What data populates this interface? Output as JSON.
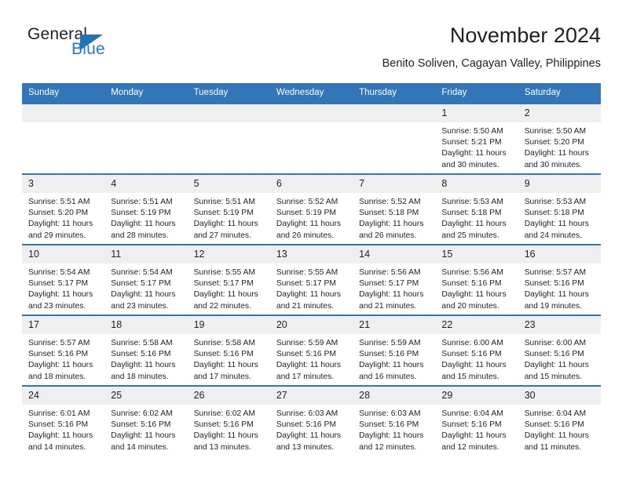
{
  "brand": {
    "name_part1": "General",
    "name_part2": "Blue",
    "triangle_color": "#2272b5",
    "text_color": "#231f20",
    "blue_text_color": "#2779bd"
  },
  "header": {
    "title": "November 2024",
    "subtitle": "Benito Soliven, Cagayan Valley, Philippines"
  },
  "theme": {
    "header_bar_color": "#3275b8",
    "daynum_band_color": "#efeff0",
    "row_divider_color": "#3275b8",
    "text_color": "#231f20"
  },
  "calendar": {
    "weekday_headers": [
      "Sunday",
      "Monday",
      "Tuesday",
      "Wednesday",
      "Thursday",
      "Friday",
      "Saturday"
    ],
    "weeks": [
      [
        {
          "day": "",
          "empty": true,
          "sunrise": "",
          "sunset": "",
          "daylight_line1": "",
          "daylight_line2": ""
        },
        {
          "day": "",
          "empty": true,
          "sunrise": "",
          "sunset": "",
          "daylight_line1": "",
          "daylight_line2": ""
        },
        {
          "day": "",
          "empty": true,
          "sunrise": "",
          "sunset": "",
          "daylight_line1": "",
          "daylight_line2": ""
        },
        {
          "day": "",
          "empty": true,
          "sunrise": "",
          "sunset": "",
          "daylight_line1": "",
          "daylight_line2": ""
        },
        {
          "day": "",
          "empty": true,
          "sunrise": "",
          "sunset": "",
          "daylight_line1": "",
          "daylight_line2": ""
        },
        {
          "day": "1",
          "empty": false,
          "sunrise": "Sunrise: 5:50 AM",
          "sunset": "Sunset: 5:21 PM",
          "daylight_line1": "Daylight: 11 hours",
          "daylight_line2": "and 30 minutes."
        },
        {
          "day": "2",
          "empty": false,
          "sunrise": "Sunrise: 5:50 AM",
          "sunset": "Sunset: 5:20 PM",
          "daylight_line1": "Daylight: 11 hours",
          "daylight_line2": "and 30 minutes."
        }
      ],
      [
        {
          "day": "3",
          "empty": false,
          "sunrise": "Sunrise: 5:51 AM",
          "sunset": "Sunset: 5:20 PM",
          "daylight_line1": "Daylight: 11 hours",
          "daylight_line2": "and 29 minutes."
        },
        {
          "day": "4",
          "empty": false,
          "sunrise": "Sunrise: 5:51 AM",
          "sunset": "Sunset: 5:19 PM",
          "daylight_line1": "Daylight: 11 hours",
          "daylight_line2": "and 28 minutes."
        },
        {
          "day": "5",
          "empty": false,
          "sunrise": "Sunrise: 5:51 AM",
          "sunset": "Sunset: 5:19 PM",
          "daylight_line1": "Daylight: 11 hours",
          "daylight_line2": "and 27 minutes."
        },
        {
          "day": "6",
          "empty": false,
          "sunrise": "Sunrise: 5:52 AM",
          "sunset": "Sunset: 5:19 PM",
          "daylight_line1": "Daylight: 11 hours",
          "daylight_line2": "and 26 minutes."
        },
        {
          "day": "7",
          "empty": false,
          "sunrise": "Sunrise: 5:52 AM",
          "sunset": "Sunset: 5:18 PM",
          "daylight_line1": "Daylight: 11 hours",
          "daylight_line2": "and 26 minutes."
        },
        {
          "day": "8",
          "empty": false,
          "sunrise": "Sunrise: 5:53 AM",
          "sunset": "Sunset: 5:18 PM",
          "daylight_line1": "Daylight: 11 hours",
          "daylight_line2": "and 25 minutes."
        },
        {
          "day": "9",
          "empty": false,
          "sunrise": "Sunrise: 5:53 AM",
          "sunset": "Sunset: 5:18 PM",
          "daylight_line1": "Daylight: 11 hours",
          "daylight_line2": "and 24 minutes."
        }
      ],
      [
        {
          "day": "10",
          "empty": false,
          "sunrise": "Sunrise: 5:54 AM",
          "sunset": "Sunset: 5:17 PM",
          "daylight_line1": "Daylight: 11 hours",
          "daylight_line2": "and 23 minutes."
        },
        {
          "day": "11",
          "empty": false,
          "sunrise": "Sunrise: 5:54 AM",
          "sunset": "Sunset: 5:17 PM",
          "daylight_line1": "Daylight: 11 hours",
          "daylight_line2": "and 23 minutes."
        },
        {
          "day": "12",
          "empty": false,
          "sunrise": "Sunrise: 5:55 AM",
          "sunset": "Sunset: 5:17 PM",
          "daylight_line1": "Daylight: 11 hours",
          "daylight_line2": "and 22 minutes."
        },
        {
          "day": "13",
          "empty": false,
          "sunrise": "Sunrise: 5:55 AM",
          "sunset": "Sunset: 5:17 PM",
          "daylight_line1": "Daylight: 11 hours",
          "daylight_line2": "and 21 minutes."
        },
        {
          "day": "14",
          "empty": false,
          "sunrise": "Sunrise: 5:56 AM",
          "sunset": "Sunset: 5:17 PM",
          "daylight_line1": "Daylight: 11 hours",
          "daylight_line2": "and 21 minutes."
        },
        {
          "day": "15",
          "empty": false,
          "sunrise": "Sunrise: 5:56 AM",
          "sunset": "Sunset: 5:16 PM",
          "daylight_line1": "Daylight: 11 hours",
          "daylight_line2": "and 20 minutes."
        },
        {
          "day": "16",
          "empty": false,
          "sunrise": "Sunrise: 5:57 AM",
          "sunset": "Sunset: 5:16 PM",
          "daylight_line1": "Daylight: 11 hours",
          "daylight_line2": "and 19 minutes."
        }
      ],
      [
        {
          "day": "17",
          "empty": false,
          "sunrise": "Sunrise: 5:57 AM",
          "sunset": "Sunset: 5:16 PM",
          "daylight_line1": "Daylight: 11 hours",
          "daylight_line2": "and 18 minutes."
        },
        {
          "day": "18",
          "empty": false,
          "sunrise": "Sunrise: 5:58 AM",
          "sunset": "Sunset: 5:16 PM",
          "daylight_line1": "Daylight: 11 hours",
          "daylight_line2": "and 18 minutes."
        },
        {
          "day": "19",
          "empty": false,
          "sunrise": "Sunrise: 5:58 AM",
          "sunset": "Sunset: 5:16 PM",
          "daylight_line1": "Daylight: 11 hours",
          "daylight_line2": "and 17 minutes."
        },
        {
          "day": "20",
          "empty": false,
          "sunrise": "Sunrise: 5:59 AM",
          "sunset": "Sunset: 5:16 PM",
          "daylight_line1": "Daylight: 11 hours",
          "daylight_line2": "and 17 minutes."
        },
        {
          "day": "21",
          "empty": false,
          "sunrise": "Sunrise: 5:59 AM",
          "sunset": "Sunset: 5:16 PM",
          "daylight_line1": "Daylight: 11 hours",
          "daylight_line2": "and 16 minutes."
        },
        {
          "day": "22",
          "empty": false,
          "sunrise": "Sunrise: 6:00 AM",
          "sunset": "Sunset: 5:16 PM",
          "daylight_line1": "Daylight: 11 hours",
          "daylight_line2": "and 15 minutes."
        },
        {
          "day": "23",
          "empty": false,
          "sunrise": "Sunrise: 6:00 AM",
          "sunset": "Sunset: 5:16 PM",
          "daylight_line1": "Daylight: 11 hours",
          "daylight_line2": "and 15 minutes."
        }
      ],
      [
        {
          "day": "24",
          "empty": false,
          "sunrise": "Sunrise: 6:01 AM",
          "sunset": "Sunset: 5:16 PM",
          "daylight_line1": "Daylight: 11 hours",
          "daylight_line2": "and 14 minutes."
        },
        {
          "day": "25",
          "empty": false,
          "sunrise": "Sunrise: 6:02 AM",
          "sunset": "Sunset: 5:16 PM",
          "daylight_line1": "Daylight: 11 hours",
          "daylight_line2": "and 14 minutes."
        },
        {
          "day": "26",
          "empty": false,
          "sunrise": "Sunrise: 6:02 AM",
          "sunset": "Sunset: 5:16 PM",
          "daylight_line1": "Daylight: 11 hours",
          "daylight_line2": "and 13 minutes."
        },
        {
          "day": "27",
          "empty": false,
          "sunrise": "Sunrise: 6:03 AM",
          "sunset": "Sunset: 5:16 PM",
          "daylight_line1": "Daylight: 11 hours",
          "daylight_line2": "and 13 minutes."
        },
        {
          "day": "28",
          "empty": false,
          "sunrise": "Sunrise: 6:03 AM",
          "sunset": "Sunset: 5:16 PM",
          "daylight_line1": "Daylight: 11 hours",
          "daylight_line2": "and 12 minutes."
        },
        {
          "day": "29",
          "empty": false,
          "sunrise": "Sunrise: 6:04 AM",
          "sunset": "Sunset: 5:16 PM",
          "daylight_line1": "Daylight: 11 hours",
          "daylight_line2": "and 12 minutes."
        },
        {
          "day": "30",
          "empty": false,
          "sunrise": "Sunrise: 6:04 AM",
          "sunset": "Sunset: 5:16 PM",
          "daylight_line1": "Daylight: 11 hours",
          "daylight_line2": "and 11 minutes."
        }
      ]
    ]
  }
}
